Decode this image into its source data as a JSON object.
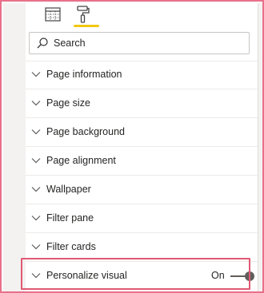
{
  "toolbar": {
    "tabs": [
      {
        "icon": "table-icon",
        "selected": false
      },
      {
        "icon": "paint-roller-icon",
        "selected": true
      }
    ],
    "accent": "#f2c811"
  },
  "search": {
    "placeholder": "Search",
    "value": ""
  },
  "sections": [
    {
      "label": "Page information",
      "icon": "chevron-down-icon"
    },
    {
      "label": "Page size",
      "icon": "chevron-down-icon"
    },
    {
      "label": "Page background",
      "icon": "chevron-down-icon"
    },
    {
      "label": "Page alignment",
      "icon": "chevron-down-icon"
    },
    {
      "label": "Wallpaper",
      "icon": "chevron-down-icon"
    },
    {
      "label": "Filter pane",
      "icon": "chevron-down-icon"
    },
    {
      "label": "Filter cards",
      "icon": "chevron-down-icon"
    },
    {
      "label": "Personalize visual",
      "icon": "chevron-down-icon",
      "toggle": {
        "label": "On",
        "state": true
      }
    }
  ],
  "colors": {
    "highlight": "#e05a72",
    "frame": "#e8708a",
    "text": "#252423"
  }
}
